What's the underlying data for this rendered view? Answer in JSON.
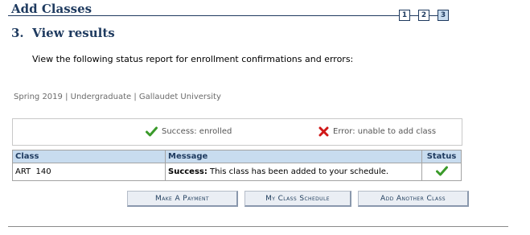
{
  "header": {
    "title": "Add Classes"
  },
  "steps": [
    {
      "label": "1",
      "current": false
    },
    {
      "label": "2",
      "current": false
    },
    {
      "label": "3",
      "current": true
    }
  ],
  "section": {
    "title": "3.  View results"
  },
  "instructions": "View the following status report for enrollment confirmations and errors:",
  "term_info": "Spring 2019 | Undergraduate | Gallaudet University",
  "legend": {
    "success_label": "Success: enrolled",
    "error_label": "Error: unable to add class",
    "success_icon": "checkmark-icon",
    "error_icon": "x-icon"
  },
  "results_table": {
    "headers": {
      "class": "Class",
      "message": "Message",
      "status": "Status"
    },
    "rows": [
      {
        "class": "ART  140",
        "message_prefix": "Success:",
        "message_text": " This class has been added to your schedule.",
        "status_icon": "checkmark-icon"
      }
    ]
  },
  "buttons": {
    "make_payment": "Make A Payment",
    "my_class_schedule": "My Class Schedule",
    "add_another_class": "Add Another Class"
  },
  "colors": {
    "header_text": "#1e3a5f",
    "table_header_bg": "#c8dcef",
    "success_green": "#3a9a2a",
    "error_red": "#d01818"
  }
}
